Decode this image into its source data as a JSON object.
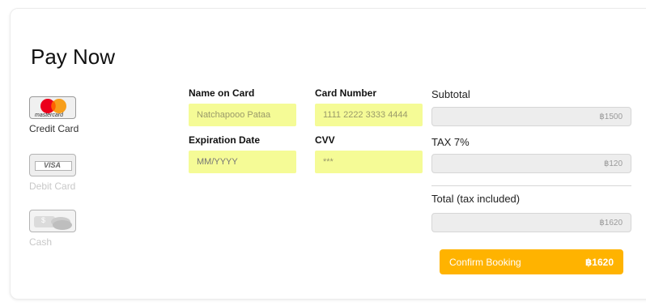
{
  "title": "Pay Now",
  "payment_methods": [
    {
      "label": "Credit Card",
      "icon": "mastercard-icon",
      "active": true
    },
    {
      "label": "Debit Card",
      "icon": "visa-icon",
      "active": false
    },
    {
      "label": "Cash",
      "icon": "cash-icon",
      "active": false
    }
  ],
  "mastercard_text": "mastercard",
  "visa_text": "VISA",
  "cash_text": "$",
  "form": {
    "name_label": "Name on Card",
    "name_value": "Natchapooo Pataa",
    "card_label": "Card Number",
    "card_value": "1111 2222 3333 4444",
    "exp_label": "Expiration Date",
    "exp_placeholder": "MM/YYYY",
    "cvv_label": "CVV",
    "cvv_value": "***"
  },
  "summary": {
    "subtotal_label": "Subtotal",
    "subtotal_value": "฿1500",
    "tax_label": "TAX 7%",
    "tax_value": "฿120",
    "total_label": "Total (tax included)",
    "total_value": "฿1620"
  },
  "confirm": {
    "label": "Confirm Booking",
    "amount": "฿1620"
  },
  "colors": {
    "accent": "#ffb300",
    "input_fill": "#f5fb96"
  }
}
